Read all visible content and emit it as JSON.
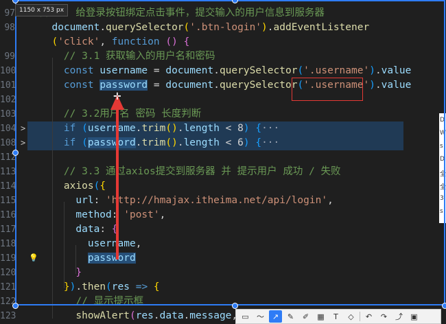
{
  "capture": {
    "size_label": "1150 x 753 px",
    "toolbar_tools": [
      "rect-select",
      "curve",
      "pen",
      "pencil",
      "marker",
      "mosaic",
      "text",
      "eraser",
      "undo",
      "redo",
      "share",
      "save"
    ],
    "side_chips": [
      "D",
      "W",
      "s",
      "D",
      "全",
      "全",
      "3",
      "s"
    ]
  },
  "editor": {
    "lines": [
      {
        "num": "97",
        "fold": "",
        "parts": [
          {
            "t": "// 3. 给登录按钮绑定点击事件，提交输入的用户信息到服务器",
            "c": "cm"
          }
        ]
      },
      {
        "num": "98",
        "fold": "",
        "parts": [
          {
            "t": "  document",
            "c": "var"
          },
          {
            "t": ".",
            "c": "pun"
          },
          {
            "t": "querySelector",
            "c": "fn"
          },
          {
            "t": "(",
            "c": "br1"
          },
          {
            "t": "'.btn-login'",
            "c": "str"
          },
          {
            "t": ")",
            "c": "br1"
          },
          {
            "t": ".",
            "c": "pun"
          },
          {
            "t": "addEventListener",
            "c": "fn"
          }
        ]
      },
      {
        "num": "",
        "fold": "",
        "parts": [
          {
            "t": "  ",
            "c": "pun"
          },
          {
            "t": "(",
            "c": "br1"
          },
          {
            "t": "'click'",
            "c": "str"
          },
          {
            "t": ", ",
            "c": "pun"
          },
          {
            "t": "function",
            "c": "kw"
          },
          {
            "t": " ",
            "c": "pun"
          },
          {
            "t": "()",
            "c": "br2"
          },
          {
            "t": " ",
            "c": "pun"
          },
          {
            "t": "{",
            "c": "br2"
          }
        ]
      },
      {
        "num": "99",
        "fold": "",
        "parts": [
          {
            "t": "    // 3.1 获取输入的用户名和密码",
            "c": "cm"
          }
        ]
      },
      {
        "num": "100",
        "fold": "",
        "parts": [
          {
            "t": "    ",
            "c": "pun"
          },
          {
            "t": "const",
            "c": "kw"
          },
          {
            "t": " ",
            "c": "pun"
          },
          {
            "t": "username",
            "c": "var"
          },
          {
            "t": " = ",
            "c": "pun"
          },
          {
            "t": "document",
            "c": "var"
          },
          {
            "t": ".",
            "c": "pun"
          },
          {
            "t": "querySelector",
            "c": "fn"
          },
          {
            "t": "(",
            "c": "br3"
          },
          {
            "t": "'.username'",
            "c": "str"
          },
          {
            "t": ")",
            "c": "br3"
          },
          {
            "t": ".",
            "c": "pun"
          },
          {
            "t": "value",
            "c": "var"
          }
        ]
      },
      {
        "num": "101",
        "fold": "",
        "parts": [
          {
            "t": "    ",
            "c": "pun"
          },
          {
            "t": "const",
            "c": "kw"
          },
          {
            "t": " ",
            "c": "pun"
          },
          {
            "t": "password",
            "c": "var sel"
          },
          {
            "t": " = ",
            "c": "pun"
          },
          {
            "t": "document",
            "c": "var"
          },
          {
            "t": ".",
            "c": "pun"
          },
          {
            "t": "querySelector",
            "c": "fn"
          },
          {
            "t": "(",
            "c": "br3"
          },
          {
            "t": "'.username'",
            "c": "str"
          },
          {
            "t": ")",
            "c": "br3"
          },
          {
            "t": ".",
            "c": "pun"
          },
          {
            "t": "value",
            "c": "var"
          }
        ]
      },
      {
        "num": "102",
        "fold": "",
        "parts": []
      },
      {
        "num": "103",
        "fold": "",
        "parts": [
          {
            "t": "    // 3.2用户名 密码 长度判断",
            "c": "cm"
          }
        ]
      },
      {
        "num": "104",
        "fold": ">",
        "hl": true,
        "parts": [
          {
            "t": "    ",
            "c": "pun"
          },
          {
            "t": "if",
            "c": "kw"
          },
          {
            "t": " ",
            "c": "pun"
          },
          {
            "t": "(",
            "c": "br3"
          },
          {
            "t": "username",
            "c": "var"
          },
          {
            "t": ".",
            "c": "pun"
          },
          {
            "t": "trim",
            "c": "fn"
          },
          {
            "t": "()",
            "c": "br1"
          },
          {
            "t": ".",
            "c": "pun"
          },
          {
            "t": "length",
            "c": "var"
          },
          {
            "t": " < 8",
            "c": "pun"
          },
          {
            "t": ")",
            "c": "br3"
          },
          {
            "t": " ",
            "c": "pun"
          },
          {
            "t": "{",
            "c": "br3"
          },
          {
            "t": "···",
            "c": "fold-dots"
          }
        ]
      },
      {
        "num": "108",
        "fold": ">",
        "hl": true,
        "parts": [
          {
            "t": "    ",
            "c": "pun"
          },
          {
            "t": "if",
            "c": "kw"
          },
          {
            "t": " ",
            "c": "pun"
          },
          {
            "t": "(",
            "c": "br3"
          },
          {
            "t": "password",
            "c": "var sel"
          },
          {
            "t": ".",
            "c": "pun"
          },
          {
            "t": "trim",
            "c": "fn"
          },
          {
            "t": "()",
            "c": "br1"
          },
          {
            "t": ".",
            "c": "pun"
          },
          {
            "t": "length",
            "c": "var"
          },
          {
            "t": " < 6",
            "c": "pun"
          },
          {
            "t": ")",
            "c": "br3"
          },
          {
            "t": " ",
            "c": "pun"
          },
          {
            "t": "{",
            "c": "br3"
          },
          {
            "t": "···",
            "c": "fold-dots"
          }
        ]
      },
      {
        "num": "112",
        "fold": "",
        "parts": []
      },
      {
        "num": "113",
        "fold": "",
        "parts": [
          {
            "t": "    // 3.3 通过axios提交到服务器 并 提示用户 成功 / 失败",
            "c": "cm"
          }
        ]
      },
      {
        "num": "114",
        "fold": "",
        "parts": [
          {
            "t": "    ",
            "c": "pun"
          },
          {
            "t": "axios",
            "c": "fn"
          },
          {
            "t": "(",
            "c": "br3"
          },
          {
            "t": "{",
            "c": "br1"
          }
        ]
      },
      {
        "num": "115",
        "fold": "",
        "parts": [
          {
            "t": "      url",
            "c": "var"
          },
          {
            "t": ": ",
            "c": "pun"
          },
          {
            "t": "'http://hmajax.itheima.net/api/login'",
            "c": "str"
          },
          {
            "t": ",",
            "c": "pun"
          }
        ]
      },
      {
        "num": "116",
        "fold": "",
        "parts": [
          {
            "t": "      method",
            "c": "var"
          },
          {
            "t": ": ",
            "c": "pun"
          },
          {
            "t": "'post'",
            "c": "str"
          },
          {
            "t": ",",
            "c": "pun"
          }
        ]
      },
      {
        "num": "117",
        "fold": "",
        "parts": [
          {
            "t": "      data",
            "c": "var"
          },
          {
            "t": ": ",
            "c": "pun"
          },
          {
            "t": "{",
            "c": "br2"
          }
        ]
      },
      {
        "num": "118",
        "fold": "",
        "parts": [
          {
            "t": "        username",
            "c": "var"
          },
          {
            "t": ",",
            "c": "pun"
          }
        ]
      },
      {
        "num": "119",
        "fold": "",
        "parts": [
          {
            "t": "        ",
            "c": "pun"
          },
          {
            "t": "password",
            "c": "var sel"
          }
        ]
      },
      {
        "num": "120",
        "fold": "",
        "parts": [
          {
            "t": "      ",
            "c": "pun"
          },
          {
            "t": "}",
            "c": "br2"
          }
        ]
      },
      {
        "num": "121",
        "fold": "",
        "parts": [
          {
            "t": "    ",
            "c": "pun"
          },
          {
            "t": "}",
            "c": "br1"
          },
          {
            "t": ")",
            "c": "br3"
          },
          {
            "t": ".",
            "c": "pun"
          },
          {
            "t": "then",
            "c": "fn"
          },
          {
            "t": "(",
            "c": "br3"
          },
          {
            "t": "res",
            "c": "var"
          },
          {
            "t": " => ",
            "c": "kw"
          },
          {
            "t": "{",
            "c": "br1"
          }
        ]
      },
      {
        "num": "122",
        "fold": "",
        "parts": [
          {
            "t": "      // 显示提示框",
            "c": "cm"
          }
        ]
      },
      {
        "num": "123",
        "fold": "",
        "parts": [
          {
            "t": "      ",
            "c": "pun"
          },
          {
            "t": "showAlert",
            "c": "fn"
          },
          {
            "t": "(",
            "c": "br2"
          },
          {
            "t": "res",
            "c": "var"
          },
          {
            "t": ".",
            "c": "pun"
          },
          {
            "t": "data",
            "c": "var"
          },
          {
            "t": ".",
            "c": "pun"
          },
          {
            "t": "message",
            "c": "var"
          },
          {
            "t": ",",
            "c": "pun"
          }
        ]
      }
    ]
  },
  "annotation": {
    "arrow_color": "#e53935"
  }
}
